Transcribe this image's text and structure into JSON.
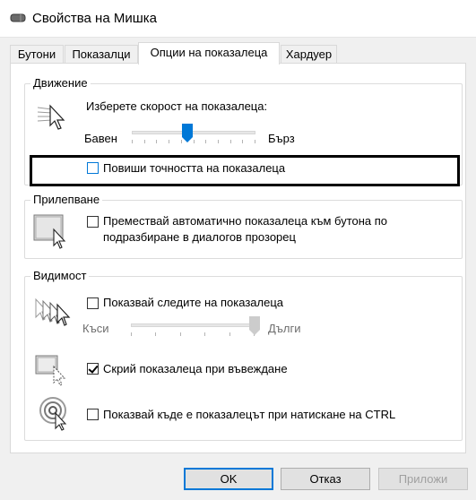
{
  "window": {
    "title": "Свойства на Мишка"
  },
  "tabs": [
    {
      "label": "Бутони"
    },
    {
      "label": "Показалци"
    },
    {
      "label": "Опции на показалеца",
      "active": true
    },
    {
      "label": "Хардуер"
    }
  ],
  "motion": {
    "group_label": "Движение",
    "speed_label": "Изберете скорост на показалеца:",
    "slow_label": "Бавен",
    "fast_label": "Бърз",
    "speed_value_fraction": 0.45,
    "precision_label": "Повиши точността на показалеца",
    "precision_checked": false
  },
  "snap_to": {
    "group_label": "Прилепване",
    "checkbox_label_line1": "Премествай автоматично показалеца към бутона по",
    "checkbox_label_line2": "подразбиране в диалогов прозорец",
    "checked": false
  },
  "visibility": {
    "group_label": "Видимост",
    "trails_label": "Показвай следите на показалеца",
    "trails_checked": false,
    "short_label": "Къси",
    "long_label": "Дълги",
    "trails_value_fraction": 1.0,
    "hide_label": "Скрий показалеца при въвеждане",
    "hide_checked": true,
    "ctrl_label": "Показвай къде е показалецът при натискане на CTRL",
    "ctrl_checked": false
  },
  "buttons": {
    "ok": "OK",
    "cancel": "Отказ",
    "apply": "Приложи"
  },
  "icons": {
    "window": "mouse-icon",
    "speed": "pointer-speed-icon",
    "snap": "snap-to-button-icon",
    "trails": "pointer-trails-icon",
    "hide": "hide-pointer-icon",
    "ctrl": "locate-pointer-icon"
  },
  "colors": {
    "accent": "#0078d7",
    "highlight_box": "#000000"
  }
}
